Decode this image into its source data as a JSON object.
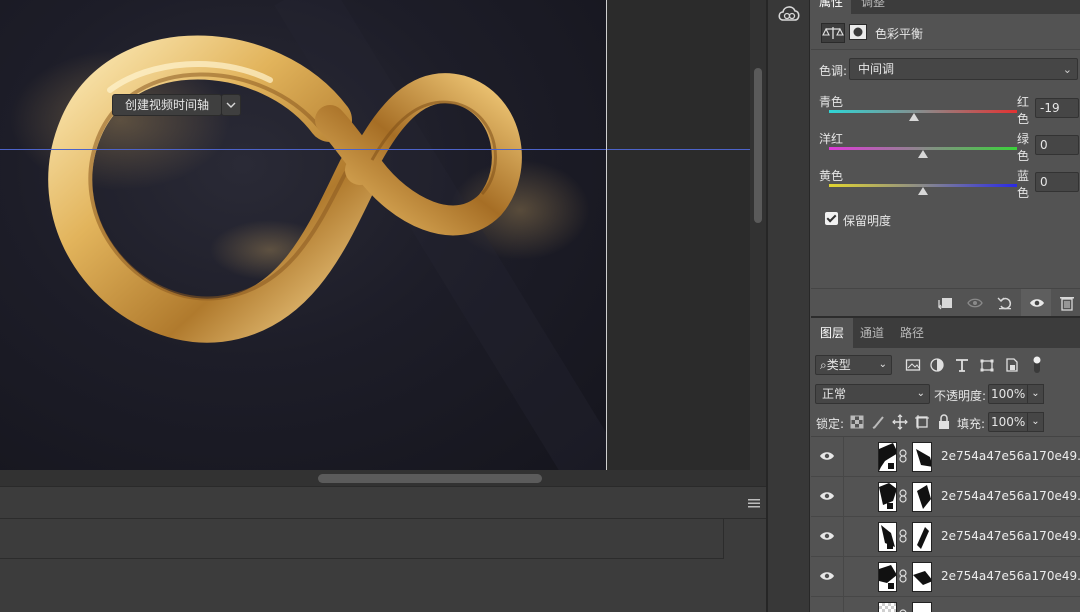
{
  "properties_panel": {
    "tabs": [
      "属性",
      "调整"
    ],
    "title": "色彩平衡",
    "tone_label": "色调:",
    "tone_value": "中间调",
    "sliders": [
      {
        "left": "青色",
        "right": "红色",
        "value": "-19",
        "position": 0.45
      },
      {
        "left": "洋红",
        "right": "绿色",
        "value": "0",
        "position": 0.5
      },
      {
        "left": "黄色",
        "right": "蓝色",
        "value": "0",
        "position": 0.5
      }
    ],
    "preserve_luminosity_label": "保留明度",
    "preserve_luminosity_checked": true
  },
  "layers_panel": {
    "tabs": [
      "图层",
      "通道",
      "路径"
    ],
    "filter_label": "类型",
    "blend_mode": "正常",
    "opacity_label": "不透明度:",
    "opacity_value": "100%",
    "lock_label": "锁定:",
    "fill_label": "填充:",
    "fill_value": "100%",
    "layers": [
      {
        "name": "2e754a47e56a170e49..."
      },
      {
        "name": "2e754a47e56a170e49..."
      },
      {
        "name": "2e754a47e56a170e49..."
      },
      {
        "name": "2e754a47e56a170e49..."
      }
    ]
  },
  "timeline": {
    "create_button_label": "创建视频时间轴"
  },
  "colors": {
    "panel_bg": "#535353",
    "dark_bg": "#3c3c3c",
    "guide": "#4c63c9",
    "gold": "#d9a449"
  }
}
